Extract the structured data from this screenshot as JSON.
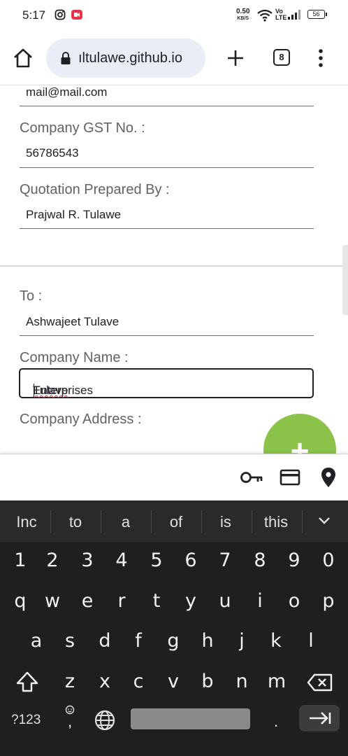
{
  "status_bar": {
    "time": "5:17",
    "net_speed": "0.50",
    "net_unit": "KB/S",
    "volte": "Vo LTE",
    "battery": "56"
  },
  "browser": {
    "url": "ıltulawe.github.io",
    "tab_count": "8"
  },
  "form": {
    "email_value": "mail@mail.com",
    "gst_label": "Company GST No. :",
    "gst_value": "56786543",
    "prepared_by_label": "Quotation Prepared By :",
    "prepared_by_value": "Prajwal R. Tulawe",
    "to_label": "To :",
    "to_value": "Ashwajeet Tulave",
    "company_name_label": "Company Name :",
    "company_name_word1": "Tulave",
    "company_name_word2": " Enterprises",
    "company_address_label": "Company Address :",
    "fab_label": "+"
  },
  "keyboard": {
    "suggestions": [
      "Inc",
      "to",
      "a",
      "of",
      "is",
      "this"
    ],
    "row_numbers": [
      "1",
      "2",
      "3",
      "4",
      "5",
      "6",
      "7",
      "8",
      "9",
      "0"
    ],
    "row_1": [
      "q",
      "w",
      "e",
      "r",
      "t",
      "y",
      "u",
      "i",
      "o",
      "p"
    ],
    "row_2": [
      "a",
      "s",
      "d",
      "f",
      "g",
      "h",
      "j",
      "k",
      "l"
    ],
    "row_3": [
      "z",
      "x",
      "c",
      "v",
      "b",
      "n",
      "m"
    ],
    "symbols_label": "?123",
    "comma_label": ",",
    "period_label": "."
  },
  "colors": {
    "fab": "#8bc34a",
    "keyboard_bg": "#1f1f1f",
    "url_bar_bg": "#e9eef6"
  }
}
